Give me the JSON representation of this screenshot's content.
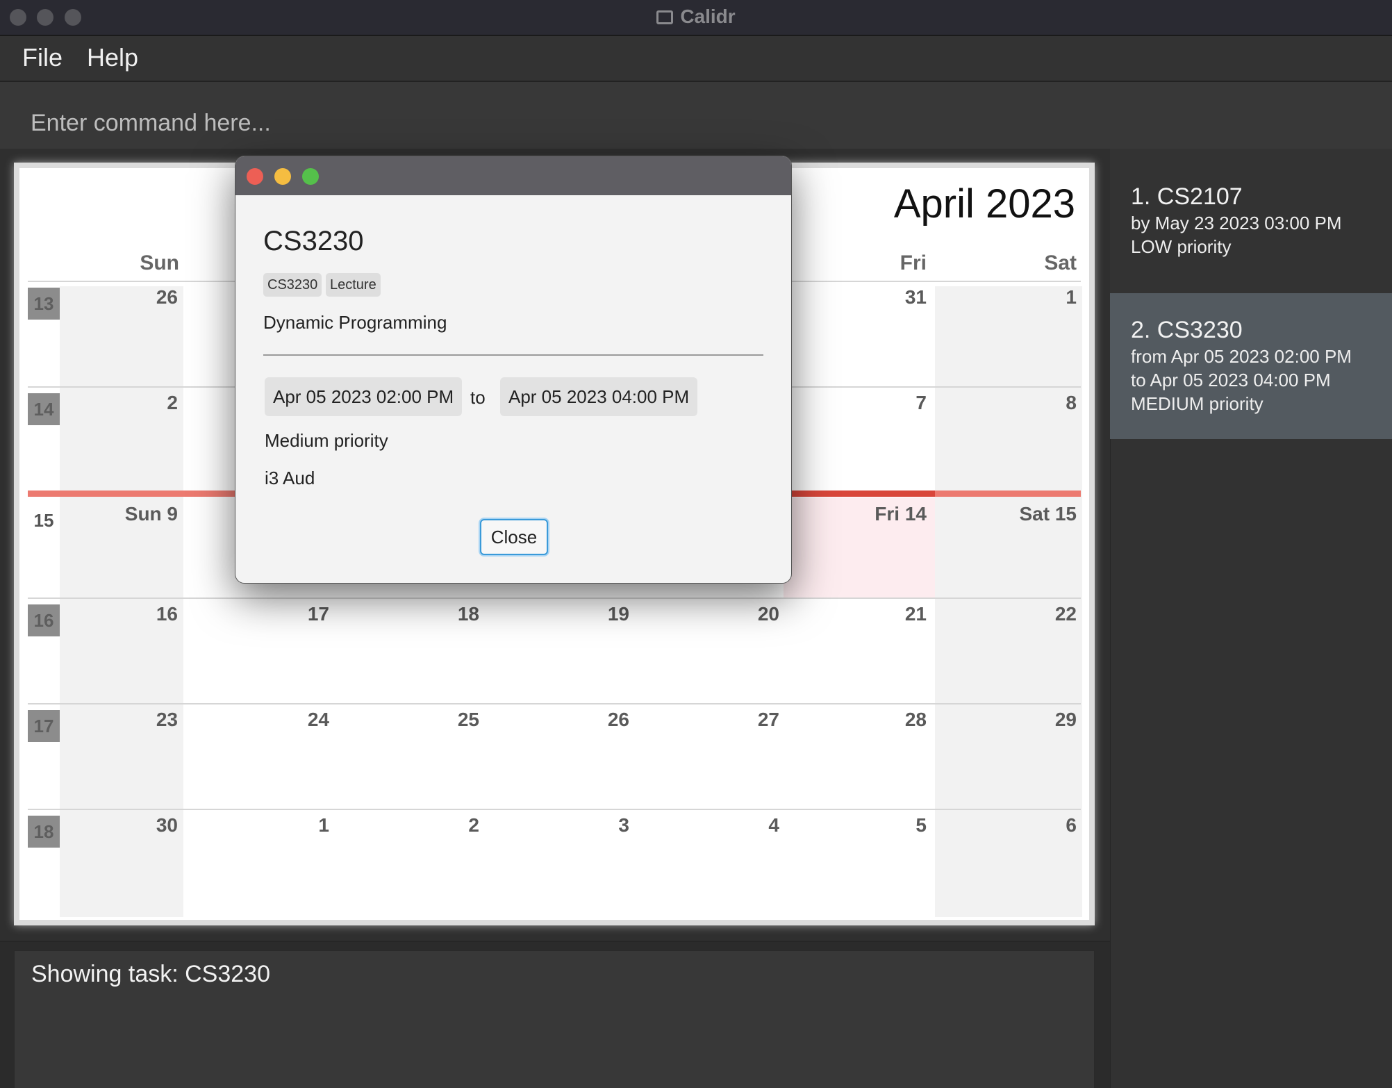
{
  "window": {
    "title": "Calidr"
  },
  "menu": {
    "file": "File",
    "help": "Help"
  },
  "command": {
    "placeholder": "Enter command here..."
  },
  "calendar": {
    "month_title": "April 2023",
    "weekday_headers": {
      "sun": "Sun",
      "fri": "Fri",
      "sat": "Sat"
    },
    "weeks": [
      {
        "week_no": "13",
        "days": [
          "26",
          "",
          "",
          "",
          "",
          "31",
          "1"
        ]
      },
      {
        "week_no": "14",
        "days": [
          "2",
          "",
          "",
          "",
          "",
          "7",
          "8"
        ]
      },
      {
        "week_no": "15",
        "days": [
          "Sun 9",
          "",
          "",
          "",
          "",
          "Fri 14",
          "Sat 15"
        ]
      },
      {
        "week_no": "16",
        "days": [
          "16",
          "17",
          "18",
          "19",
          "20",
          "21",
          "22"
        ]
      },
      {
        "week_no": "17",
        "days": [
          "23",
          "24",
          "25",
          "26",
          "27",
          "28",
          "29"
        ]
      },
      {
        "week_no": "18",
        "days": [
          "30",
          "1",
          "2",
          "3",
          "4",
          "5",
          "6"
        ]
      }
    ]
  },
  "dialog": {
    "name": "CS3230",
    "tags": [
      "CS3230",
      "Lecture"
    ],
    "description": "Dynamic Programming",
    "from": "Apr 05 2023 02:00 PM",
    "to_label": "to",
    "to": "Apr 05 2023 04:00 PM",
    "priority": "Medium priority",
    "location": "i3 Aud",
    "close_label": "Close"
  },
  "tasks": [
    {
      "title": "1.  CS2107",
      "lines": [
        "by May 23 2023 03:00 PM",
        "LOW priority"
      ]
    },
    {
      "title": "2.  CS3230",
      "lines": [
        "from Apr 05 2023 02:00 PM",
        "to Apr 05 2023 04:00 PM",
        "MEDIUM priority"
      ]
    }
  ],
  "result": {
    "text": "Showing task: CS3230"
  }
}
